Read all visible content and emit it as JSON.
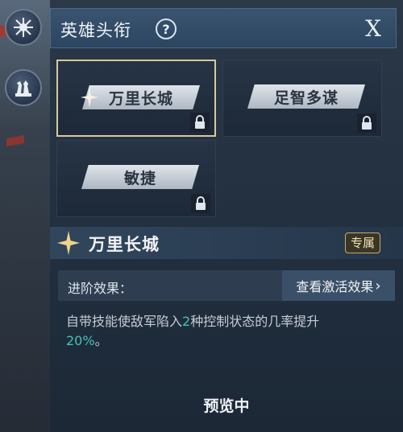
{
  "side": {
    "top_icon": "snowflake-emblem-icon",
    "chess_icon": "chess-pieces-icon"
  },
  "header": {
    "title": "英雄头衔",
    "help": "?",
    "close": "X"
  },
  "titles": [
    {
      "label": "万里长城",
      "selected": true,
      "locked": true
    },
    {
      "label": "足智多谋",
      "selected": false,
      "locked": true
    },
    {
      "label": "敏捷",
      "selected": false,
      "locked": true
    }
  ],
  "detail": {
    "title": "万里长城",
    "badge": "专属",
    "advance_label": "进阶效果：",
    "view_button": "查看激活效果",
    "desc_prefix": "自带技能使敌军陷入",
    "desc_num": "2",
    "desc_mid": "种控制状态的几率提升",
    "desc_percent": "20%",
    "desc_end": "。"
  },
  "footer": {
    "preview": "预览中"
  },
  "colors": {
    "highlight": "#45c3b8",
    "selected_border": "#d8c89a",
    "badge_gold": "#c9ab6a"
  }
}
